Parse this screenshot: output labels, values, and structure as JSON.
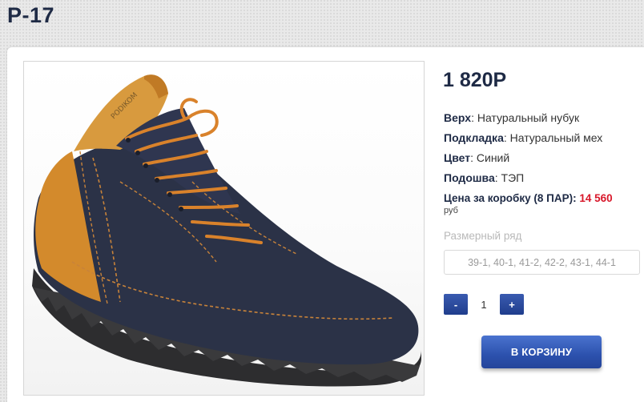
{
  "product": {
    "title": "P-17",
    "price": "1 820Р",
    "image_alt": "shoe-photo"
  },
  "specs": [
    {
      "label": "Верх",
      "value": ": Натуральный нубук"
    },
    {
      "label": "Подкладка",
      "value": ": Натуральный мех"
    },
    {
      "label": "Цвет",
      "value": ": Синий"
    },
    {
      "label": "Подошва",
      "value": ": ТЭП"
    }
  ],
  "box_price": {
    "label": "Цена за коробку (8 ПАР):",
    "amount": "14 560",
    "currency": "руб"
  },
  "sizes": {
    "label": "Размерный ряд",
    "value": "39-1, 40-1, 41-2, 42-2, 43-1, 44-1"
  },
  "quantity": {
    "minus": "-",
    "value": "1",
    "plus": "+"
  },
  "cart_button": "В КОРЗИНУ",
  "colors": {
    "title": "#1e2a45",
    "accent": "#2c51ad",
    "price_red": "#d8172a",
    "nubuck_blue": "#2b3247",
    "nubuck_orange": "#d38a2c"
  }
}
